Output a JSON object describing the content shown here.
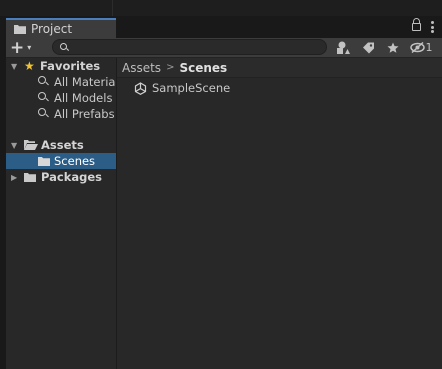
{
  "window": {
    "tab_label": "Project"
  },
  "toolbar": {
    "add_glyph": "+",
    "add_caret": "▾",
    "search_value": "",
    "hidden_count": "1"
  },
  "sidebar": {
    "favorites": {
      "label": "Favorites",
      "items": [
        {
          "label": "All Materia"
        },
        {
          "label": "All Models"
        },
        {
          "label": "All Prefabs"
        }
      ]
    },
    "assets": {
      "label": "Assets",
      "children": [
        {
          "label": "Scenes",
          "selected": true
        }
      ]
    },
    "packages": {
      "label": "Packages"
    }
  },
  "main": {
    "breadcrumb": [
      "Assets",
      "Scenes"
    ],
    "breadcrumb_separator": ">",
    "items": [
      {
        "label": "SampleScene",
        "icon": "unity-scene-icon"
      }
    ]
  },
  "colors": {
    "selection": "#2c5d87",
    "favorite_star": "#f0c330",
    "tab_accent": "#4a7fbf"
  }
}
